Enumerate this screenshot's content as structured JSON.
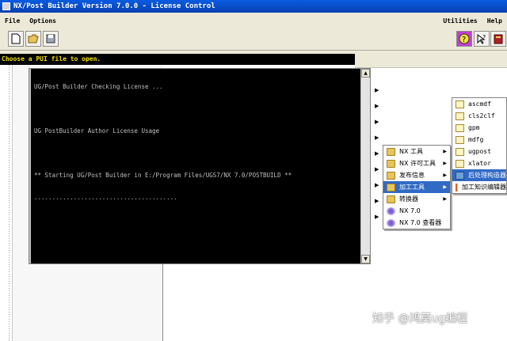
{
  "window": {
    "title": "NX/Post Builder Version 7.0.0 - License Control"
  },
  "menu": {
    "file": "File",
    "options": "Options",
    "utilities": "Utilities",
    "help": "Help"
  },
  "toolbar": {
    "new_icon": "new-file-icon",
    "open_icon": "open-folder-icon",
    "save_icon": "save-icon",
    "help_icon": "help-icon",
    "whats_this_icon": "whats-this-icon",
    "manual_icon": "manual-book-icon"
  },
  "status": {
    "message": "Choose a PUI file to open."
  },
  "console": {
    "lines": [
      "UG/Post Builder Checking License ...",
      "",
      "UG PostBuilder Author License Usage",
      "",
      "** Starting UG/Post Builder in E:/Program Files/UGS7/NX 7.0/POSTBUILD **",
      "........................................"
    ]
  },
  "menu_nx": {
    "items": [
      {
        "label": "NX 工具",
        "icon": "folder-icon",
        "has_sub": true
      },
      {
        "label": "NX 许可工具",
        "icon": "folder-icon",
        "has_sub": true
      },
      {
        "label": "发布信息",
        "icon": "folder-icon",
        "has_sub": true
      },
      {
        "label": "加工工具",
        "icon": "folder-icon",
        "has_sub": true,
        "selected": true
      },
      {
        "label": "转换器",
        "icon": "folder-icon",
        "has_sub": true
      },
      {
        "label": "NX 7.0",
        "icon": "nx-icon",
        "has_sub": false
      },
      {
        "label": "NX 7.0 查看器",
        "icon": "nx-icon",
        "has_sub": false
      }
    ]
  },
  "menu_mfg": {
    "items": [
      {
        "label": "ascmdf",
        "icon": "file-icon"
      },
      {
        "label": "cls2clf",
        "icon": "file-icon"
      },
      {
        "label": "gpm",
        "icon": "file-icon"
      },
      {
        "label": "mdfg",
        "icon": "file-icon"
      },
      {
        "label": "ugpost",
        "icon": "file-icon"
      },
      {
        "label": "xlator",
        "icon": "file-icon"
      },
      {
        "label": "后处理构造器",
        "icon": "post-builder-icon",
        "selected": true
      },
      {
        "label": "加工知识编辑器",
        "icon": "grid-icon"
      }
    ]
  },
  "watermark": {
    "text": "知乎 @鸿莫ug编程"
  }
}
